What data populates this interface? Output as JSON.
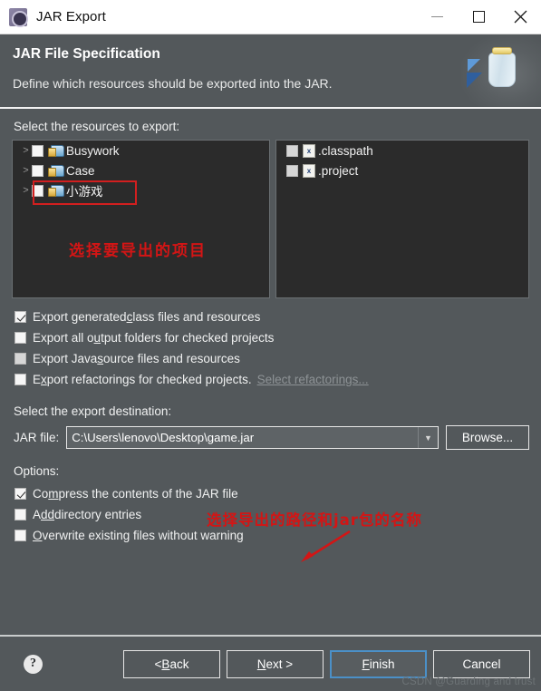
{
  "window": {
    "title": "JAR Export",
    "icon": "jar-export-icon",
    "controls": {
      "minimize": "minimize-icon",
      "maximize": "maximize-icon",
      "close": "close-icon"
    }
  },
  "banner": {
    "title": "JAR File Specification",
    "subtitle": "Define which resources should be exported into the JAR.",
    "art_icon": "jar-bottle-icon"
  },
  "resources": {
    "label": "Select the resources to export:",
    "tree": [
      {
        "twisty": ">",
        "checked": false,
        "icon": "java-project-icon",
        "label": "Busywork",
        "highlighted": false
      },
      {
        "twisty": ">",
        "checked": false,
        "icon": "java-project-icon",
        "label": "Case",
        "highlighted": false
      },
      {
        "twisty": ">",
        "checked": false,
        "icon": "java-project-icon",
        "label": "小游戏",
        "highlighted": true
      }
    ],
    "files": [
      {
        "checked": false,
        "icon": "xml-file-icon",
        "glyph": "x",
        "label": ".classpath"
      },
      {
        "checked": false,
        "icon": "xml-file-icon",
        "glyph": "x",
        "label": ".project"
      }
    ],
    "annotation": "选择要导出的项目"
  },
  "export_options": [
    {
      "checked": true,
      "pre": "Export generated ",
      "mnemonic": "c",
      "post": "lass files and resources"
    },
    {
      "checked": false,
      "pre": "Export all o",
      "mnemonic": "u",
      "post": "tput folders for checked projects"
    },
    {
      "checked": false,
      "pre": "Export Java ",
      "mnemonic": "s",
      "post": "ource files and resources"
    },
    {
      "checked": false,
      "pre": "E",
      "mnemonic": "x",
      "post": "port refactorings for checked projects.",
      "link": "Select refactorings..."
    }
  ],
  "destination": {
    "label": "Select the export destination:",
    "field_label": "JAR file:",
    "value": "C:\\Users\\lenovo\\Desktop\\game.jar",
    "dropdown_icon": "chevron-down-icon",
    "browse_button": "Browse...",
    "annotation": "选择导出的路径和jar包的名称"
  },
  "options": {
    "label": "Options:",
    "items": [
      {
        "checked": true,
        "pre": "Co",
        "mnemonic": "m",
        "post": "press the contents of the JAR file"
      },
      {
        "checked": false,
        "pre": "A",
        "mnemonic": "dd",
        "post": " directory entries"
      },
      {
        "checked": false,
        "pre": "",
        "mnemonic": "O",
        "post": "verwrite existing files without warning"
      }
    ]
  },
  "footer": {
    "help_icon": "help-icon",
    "help_glyph": "?",
    "buttons": [
      {
        "pre": "< ",
        "mnemonic": "B",
        "post": "ack",
        "default": false
      },
      {
        "pre": "",
        "mnemonic": "N",
        "post": "ext >",
        "default": false
      },
      {
        "pre": "",
        "mnemonic": "F",
        "post": "inish",
        "default": true
      },
      {
        "pre": "",
        "mnemonic": "",
        "post": "Cancel",
        "default": false
      }
    ]
  },
  "watermark": "CSDN @Guarding and trust",
  "colors": {
    "dialog_bg": "#53585b",
    "panel_bg": "#2b2b2b",
    "annotation_red": "#d31515",
    "default_button_border": "#4b90c8",
    "text": "#f0f1f1"
  }
}
